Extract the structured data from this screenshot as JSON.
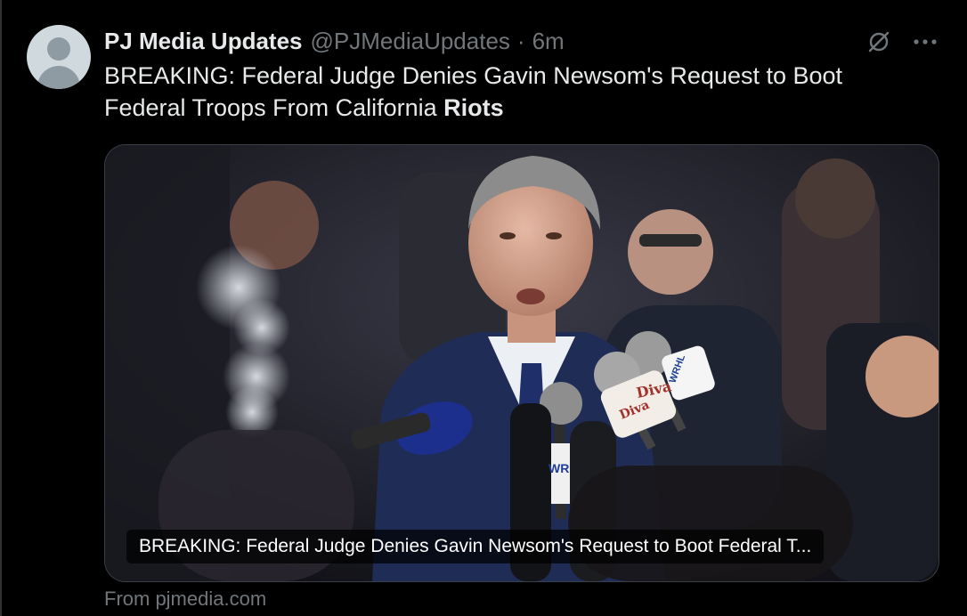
{
  "tweet": {
    "author_name": "PJ Media Updates",
    "handle": "@PJMediaUpdates",
    "separator": "·",
    "time": "6m",
    "text_main": "BREAKING: Federal Judge Denies Gavin Newsom's Request to Boot Federal Troops From California ",
    "text_bold": "Riots"
  },
  "card": {
    "title": "BREAKING: Federal Judge Denies Gavin Newsom's Request to Boot Federal T...",
    "mic_labels": [
      "Diva",
      "Diva",
      "WRHL",
      "WR"
    ]
  },
  "source": "From pjmedia.com",
  "icons": {
    "grok": "grok-icon",
    "more": "more-icon",
    "avatar": "default-avatar"
  },
  "colors": {
    "background": "#000000",
    "primary_text": "#e7e9ea",
    "secondary_text": "#71767b",
    "card_border": "#3a3f44"
  }
}
